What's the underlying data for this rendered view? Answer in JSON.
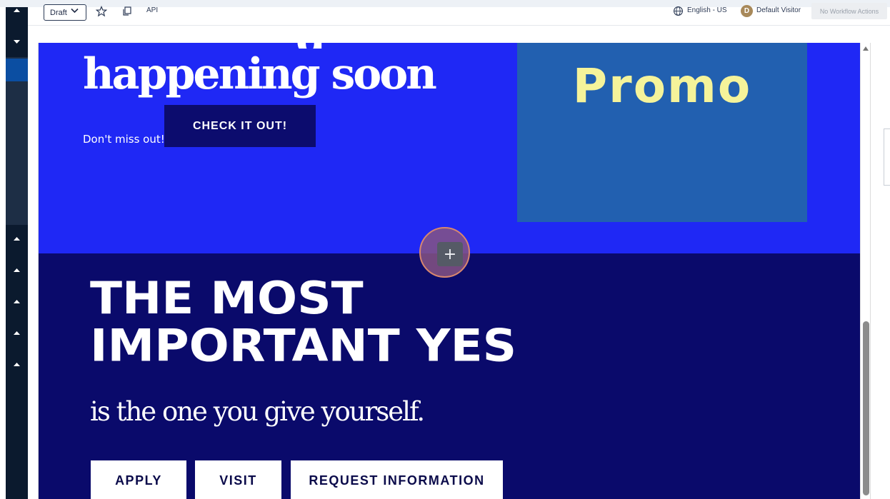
{
  "toolbar": {
    "status": "Draft",
    "api_label": "API",
    "language": "English - US",
    "visitor_initial": "D",
    "visitor": "Default Visitor",
    "workflow": "No Workflow Actions"
  },
  "icons": {
    "status_dropdown": "chevron-down-icon",
    "favorite": "star-icon",
    "copy": "copy-icon",
    "language": "globe-icon",
    "add_section": "plus-icon",
    "rail_arrows": [
      "caret-up-icon",
      "caret-down-icon",
      "caret-up-icon",
      "caret-up-icon",
      "caret-up-icon",
      "caret-up-icon",
      "caret-up-icon"
    ]
  },
  "hero": {
    "heading": "happening soon",
    "heading_fragment": "g",
    "subtext": "Don't miss out!",
    "cta": "CHECK IT OUT!",
    "promo": "Promo"
  },
  "section2": {
    "heading_line1": "THE MOST",
    "heading_line2": "IMPORTANT YES",
    "tagline": "is the one you give yourself.",
    "buttons": [
      "APPLY",
      "VISIT",
      "REQUEST INFORMATION"
    ]
  },
  "add_button": "+",
  "colors": {
    "hero_bg": "#1f28f5",
    "section2_bg": "#0a0a6b",
    "promo_bg": "#2260b0",
    "promo_text": "#f5f39a",
    "rail_bg": "#0b1a2e",
    "rail_active": "#0b4ea2"
  }
}
